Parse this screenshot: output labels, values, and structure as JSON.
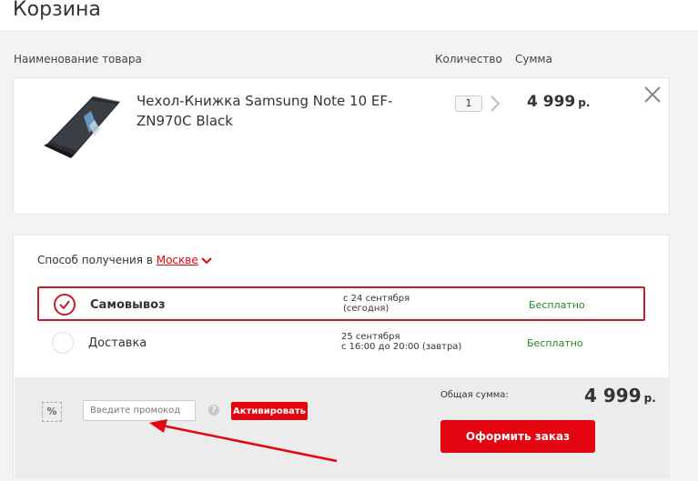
{
  "page": {
    "title": "Корзина"
  },
  "table_headers": {
    "name": "Наименование товара",
    "quantity": "Количество",
    "sum": "Сумма"
  },
  "product": {
    "name": "Чехол-Книжка Samsung Note 10 EF-ZN970C Black",
    "quantity": "1",
    "price": "4 999",
    "currency": "р."
  },
  "receipt": {
    "label": "Способ получения в",
    "city": "Москве",
    "options": [
      {
        "name": "Самовывоз",
        "date_line1": "с 24 сентября",
        "date_line2": "(сегодня)",
        "price": "Бесплатно",
        "selected": true
      },
      {
        "name": "Доставка",
        "date_line1": "25 сентября",
        "date_line2": "с 16:00 до 20:00 (завтра)",
        "price": "Бесплатно",
        "selected": false
      }
    ]
  },
  "promo": {
    "icon_text": "%",
    "placeholder": "Введите промокод",
    "help": "?",
    "activate_label": "Активировать"
  },
  "total": {
    "label": "Общая сумма:",
    "value": "4 999",
    "currency": "р."
  },
  "order_button": "Оформить заказ",
  "colors": {
    "accent": "#e30611",
    "free_green": "#1f8a1f",
    "selected_border": "#c0202a"
  }
}
